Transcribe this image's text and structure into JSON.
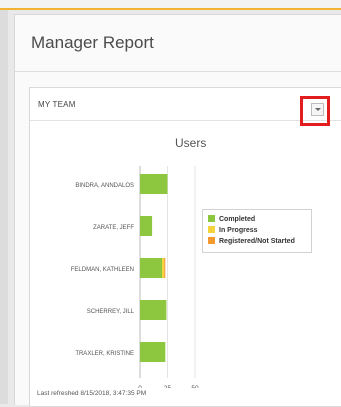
{
  "page": {
    "title": "Manager Report"
  },
  "card": {
    "title": "MY TEAM",
    "dropdown_icon": "chevron-down-icon",
    "last_refreshed": "Last refreshed 8/15/2018, 3:47:35 PM"
  },
  "chart_data": {
    "type": "bar",
    "orientation": "horizontal",
    "stacked": true,
    "title": "Users",
    "categories": [
      "BINDRA, ANNDALOS",
      "ZARATE, JEFF",
      "FELDMAN, KATHLEEN",
      "SCHERREY, JILL",
      "TRAXLER, KRISTINE"
    ],
    "series": [
      {
        "name": "Completed",
        "color": "#8dc63f",
        "values": [
          25,
          11,
          20,
          24,
          23
        ]
      },
      {
        "name": "In Progress",
        "color": "#f5d33d",
        "values": [
          0,
          0,
          2,
          0,
          0
        ]
      },
      {
        "name": "Registered/Not Started",
        "color": "#f29a2e",
        "values": [
          0,
          0,
          1,
          0,
          0
        ]
      }
    ],
    "x_ticks": [
      "0",
      "25",
      "50"
    ],
    "xlim": [
      0,
      50
    ],
    "grid": true,
    "legend_position": "right"
  },
  "colors": {
    "accent": "#f2b233",
    "highlight": "#e31d1d"
  }
}
